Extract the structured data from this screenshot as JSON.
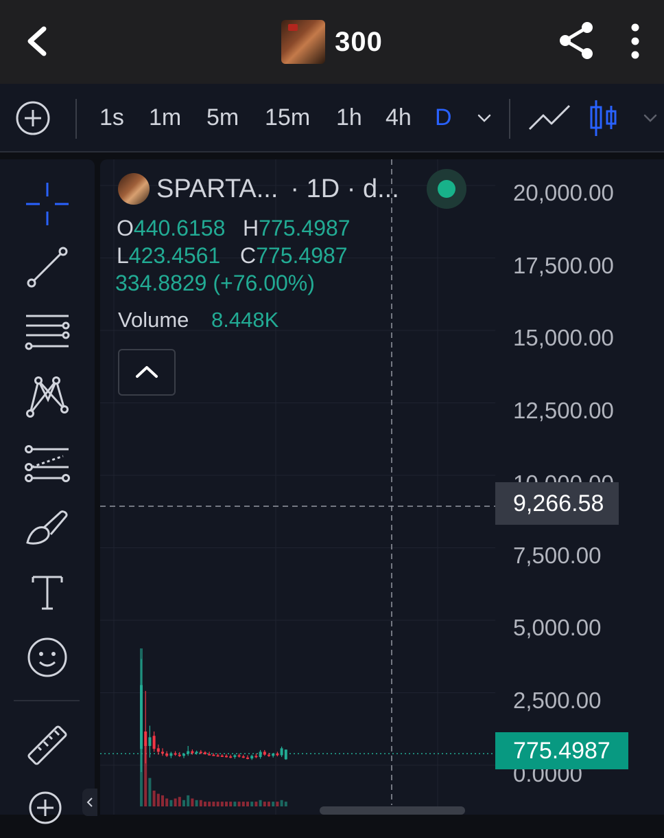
{
  "header": {
    "back_icon": "chevron-left-icon",
    "title": "300",
    "share_icon": "share-icon",
    "more_icon": "more-vertical-icon"
  },
  "timeframes": {
    "add_icon": "plus-circle-icon",
    "items": [
      "1s",
      "1m",
      "5m",
      "15m",
      "1h",
      "4h",
      "D"
    ],
    "active": "D",
    "chart_types": [
      "line-chart-icon",
      "candlestick-icon"
    ],
    "accent_color": "#2962ff"
  },
  "tools": [
    "crosshair-icon",
    "trend-line-icon",
    "fib-levels-icon",
    "pattern-icon",
    "projection-icon",
    "brush-icon",
    "text-icon",
    "emoji-icon",
    "ruler-icon",
    "zoom-in-icon"
  ],
  "legend": {
    "symbol": "SPARTA...",
    "meta": "· 1D · d...",
    "open_key": "O",
    "open": "440.6158",
    "high_key": "H",
    "high": "775.4987",
    "low_key": "L",
    "low": "423.4561",
    "close_key": "C",
    "close": "775.4987",
    "change": "334.8829 (+76.00%)",
    "volume_label": "Volume",
    "volume_value": "8.448K",
    "up_color": "#22ab94"
  },
  "price_scale": {
    "labels": [
      "20,000.00",
      "17,500.00",
      "15,000.00",
      "12,500.00",
      "10,000.00",
      "7,500.00",
      "5,000.00",
      "2,500.00",
      "0.0000"
    ],
    "crosshair_value": "9,266.58",
    "last_price": "775.4987",
    "last_price_color": "#089981"
  },
  "chart_data": {
    "type": "candlestick",
    "ylim": [
      0,
      20000
    ],
    "crosshair_price": 9266.58,
    "last_price": 775.4987,
    "candles": [
      {
        "o": 800,
        "h": 3900,
        "l": 0,
        "c": 3000
      },
      {
        "o": 1400,
        "h": 2800,
        "l": 300,
        "c": 900
      },
      {
        "o": 900,
        "h": 1600,
        "l": 500,
        "c": 1200
      },
      {
        "o": 1250,
        "h": 1400,
        "l": 700,
        "c": 800
      },
      {
        "o": 820,
        "h": 950,
        "l": 600,
        "c": 700
      },
      {
        "o": 700,
        "h": 820,
        "l": 560,
        "c": 640
      },
      {
        "o": 640,
        "h": 720,
        "l": 520,
        "c": 560
      },
      {
        "o": 560,
        "h": 700,
        "l": 480,
        "c": 650
      },
      {
        "o": 650,
        "h": 720,
        "l": 560,
        "c": 600
      },
      {
        "o": 600,
        "h": 690,
        "l": 520,
        "c": 560
      },
      {
        "o": 560,
        "h": 660,
        "l": 480,
        "c": 630
      },
      {
        "o": 630,
        "h": 900,
        "l": 560,
        "c": 720
      },
      {
        "o": 720,
        "h": 780,
        "l": 600,
        "c": 650
      },
      {
        "o": 650,
        "h": 740,
        "l": 600,
        "c": 700
      },
      {
        "o": 700,
        "h": 760,
        "l": 620,
        "c": 680
      },
      {
        "o": 680,
        "h": 720,
        "l": 600,
        "c": 620
      },
      {
        "o": 620,
        "h": 700,
        "l": 580,
        "c": 600
      },
      {
        "o": 600,
        "h": 650,
        "l": 560,
        "c": 580
      },
      {
        "o": 580,
        "h": 640,
        "l": 540,
        "c": 570
      },
      {
        "o": 570,
        "h": 620,
        "l": 520,
        "c": 560
      },
      {
        "o": 560,
        "h": 620,
        "l": 500,
        "c": 540
      },
      {
        "o": 540,
        "h": 600,
        "l": 480,
        "c": 520
      },
      {
        "o": 520,
        "h": 620,
        "l": 460,
        "c": 580
      },
      {
        "o": 580,
        "h": 640,
        "l": 500,
        "c": 540
      },
      {
        "o": 540,
        "h": 600,
        "l": 480,
        "c": 500
      },
      {
        "o": 500,
        "h": 580,
        "l": 440,
        "c": 470
      },
      {
        "o": 470,
        "h": 600,
        "l": 420,
        "c": 560
      },
      {
        "o": 560,
        "h": 640,
        "l": 480,
        "c": 520
      },
      {
        "o": 520,
        "h": 760,
        "l": 460,
        "c": 700
      },
      {
        "o": 700,
        "h": 760,
        "l": 560,
        "c": 600
      },
      {
        "o": 600,
        "h": 660,
        "l": 520,
        "c": 560
      },
      {
        "o": 560,
        "h": 660,
        "l": 500,
        "c": 640
      },
      {
        "o": 640,
        "h": 700,
        "l": 540,
        "c": 580
      },
      {
        "o": 580,
        "h": 880,
        "l": 520,
        "c": 820
      },
      {
        "o": 440.6158,
        "h": 775.4987,
        "l": 423.4561,
        "c": 775.4987
      }
    ],
    "volumes": [
      100,
      40,
      18,
      10,
      8,
      7,
      5,
      4,
      5,
      6,
      4,
      7,
      5,
      4,
      4,
      3,
      3,
      3,
      3,
      3,
      3,
      3,
      3,
      3,
      3,
      3,
      3,
      3,
      4,
      3,
      3,
      3,
      3,
      4,
      3
    ],
    "up_color": "#22ab94",
    "down_color": "#f23645"
  }
}
